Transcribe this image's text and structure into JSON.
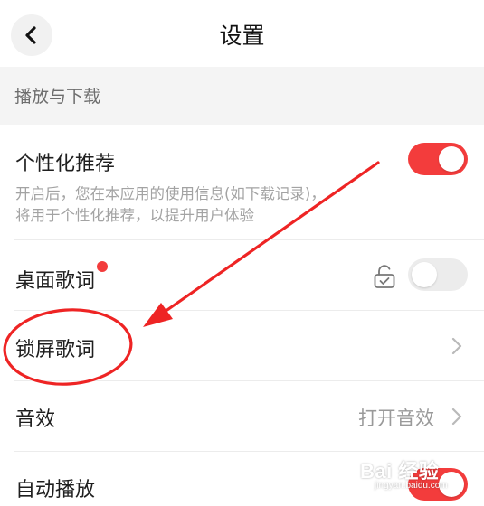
{
  "header": {
    "title": "设置",
    "back_icon": "chevron-left-icon"
  },
  "section": {
    "title": "播放与下载"
  },
  "rows": {
    "personalized": {
      "title": "个性化推荐",
      "desc_line1": "开启后，您在本应用的使用信息(如下载记录)，",
      "desc_line2": "将用于个性化推荐，以提升用户体验",
      "toggle_on": true
    },
    "desktop_lyrics": {
      "title": "桌面歌词",
      "lock_icon": "unlock-icon",
      "toggle_on": false
    },
    "lock_screen_lyrics": {
      "title": "锁屏歌词"
    },
    "sound_effect": {
      "title": "音效",
      "value": "打开音效"
    },
    "autoplay": {
      "title": "自动播放",
      "toggle_on": true
    }
  },
  "watermark": {
    "main": "Bai 经验",
    "sub": "jingyan.baidu.com"
  },
  "colors": {
    "accent": "#f33c3c",
    "annotation": "#ee2424",
    "section_bg": "#f4f4f4"
  }
}
